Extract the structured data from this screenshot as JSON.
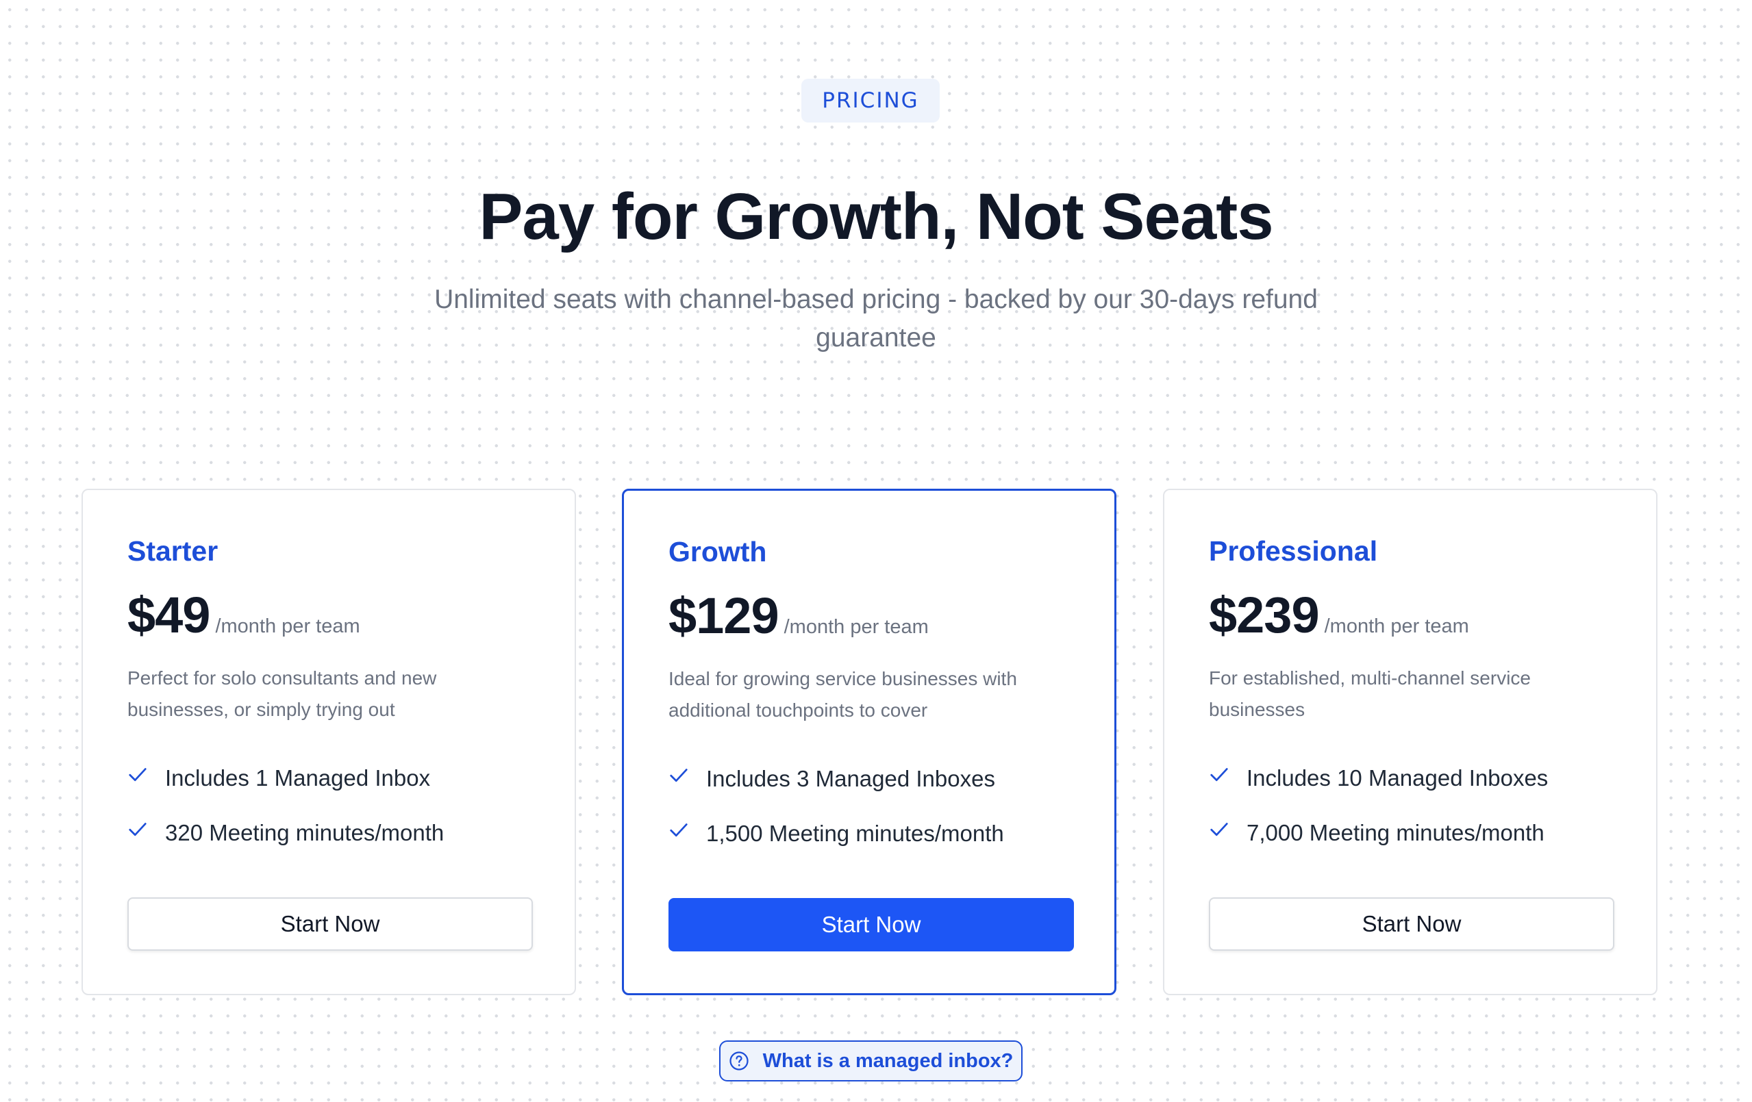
{
  "header": {
    "eyebrow": "PRICING",
    "title": "Pay for Growth, Not Seats",
    "subtitle": "Unlimited seats with channel-based pricing - backed by our 30-days refund guarantee"
  },
  "plans": [
    {
      "name": "Starter",
      "price": "$49",
      "period": "/month per team",
      "description": "Perfect for solo consultants and new businesses, or simply trying out",
      "features": [
        "Includes 1 Managed Inbox",
        "320 Meeting minutes/month"
      ],
      "cta": "Start Now",
      "featured": false
    },
    {
      "name": "Growth",
      "price": "$129",
      "period": "/month per team",
      "description": "Ideal for growing service businesses with additional touchpoints to cover",
      "features": [
        "Includes 3 Managed Inboxes",
        "1,500 Meeting minutes/month"
      ],
      "cta": "Start Now",
      "featured": true
    },
    {
      "name": "Professional",
      "price": "$239",
      "period": "/month per team",
      "description": "For established, multi-channel service businesses",
      "features": [
        "Includes 10 Managed Inboxes",
        "7,000 Meeting minutes/month"
      ],
      "cta": "Start Now",
      "featured": false
    }
  ],
  "faq": {
    "label": "What is a managed inbox?",
    "icon": "question-circle-icon"
  },
  "colors": {
    "accent": "#1d4ed8",
    "primary_button": "#1d56f5",
    "eyebrow_bg": "#eef3fc",
    "heading": "#111827",
    "muted": "#6b7280"
  },
  "icons": {
    "feature": "check-icon"
  }
}
